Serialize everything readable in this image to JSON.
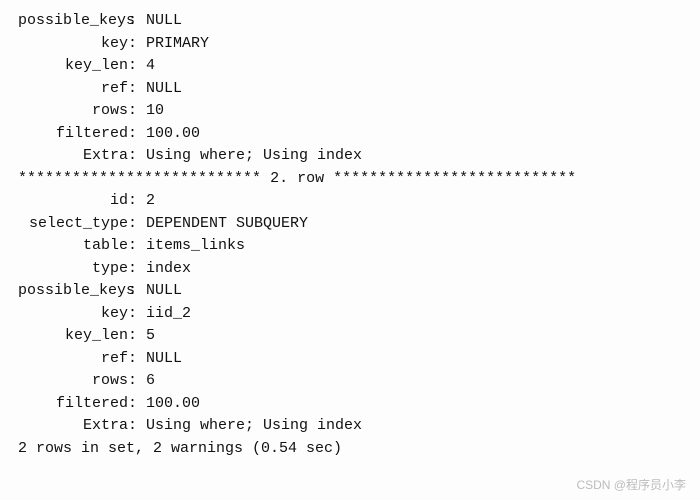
{
  "rows": [
    {
      "separator_label": "2. row",
      "separator_stars_before": "***************************",
      "separator_stars_after": "***************************",
      "fields": [
        {
          "label": "possible_keys",
          "value": "NULL"
        },
        {
          "label": "key",
          "value": "PRIMARY"
        },
        {
          "label": "key_len",
          "value": "4"
        },
        {
          "label": "ref",
          "value": "NULL"
        },
        {
          "label": "rows",
          "value": "10"
        },
        {
          "label": "filtered",
          "value": "100.00"
        },
        {
          "label": "Extra",
          "value": "Using where; Using index"
        }
      ]
    },
    {
      "fields": [
        {
          "label": "id",
          "value": "2"
        },
        {
          "label": "select_type",
          "value": "DEPENDENT SUBQUERY"
        },
        {
          "label": "table",
          "value": "items_links"
        },
        {
          "label": "type",
          "value": "index"
        },
        {
          "label": "possible_keys",
          "value": "NULL"
        },
        {
          "label": "key",
          "value": "iid_2"
        },
        {
          "label": "key_len",
          "value": "5"
        },
        {
          "label": "ref",
          "value": "NULL"
        },
        {
          "label": "rows",
          "value": "6"
        },
        {
          "label": "filtered",
          "value": "100.00"
        },
        {
          "label": "Extra",
          "value": "Using where; Using index"
        }
      ]
    }
  ],
  "summary": "2 rows in set, 2 warnings (0.54 sec)",
  "watermark": "CSDN @程序员小李"
}
